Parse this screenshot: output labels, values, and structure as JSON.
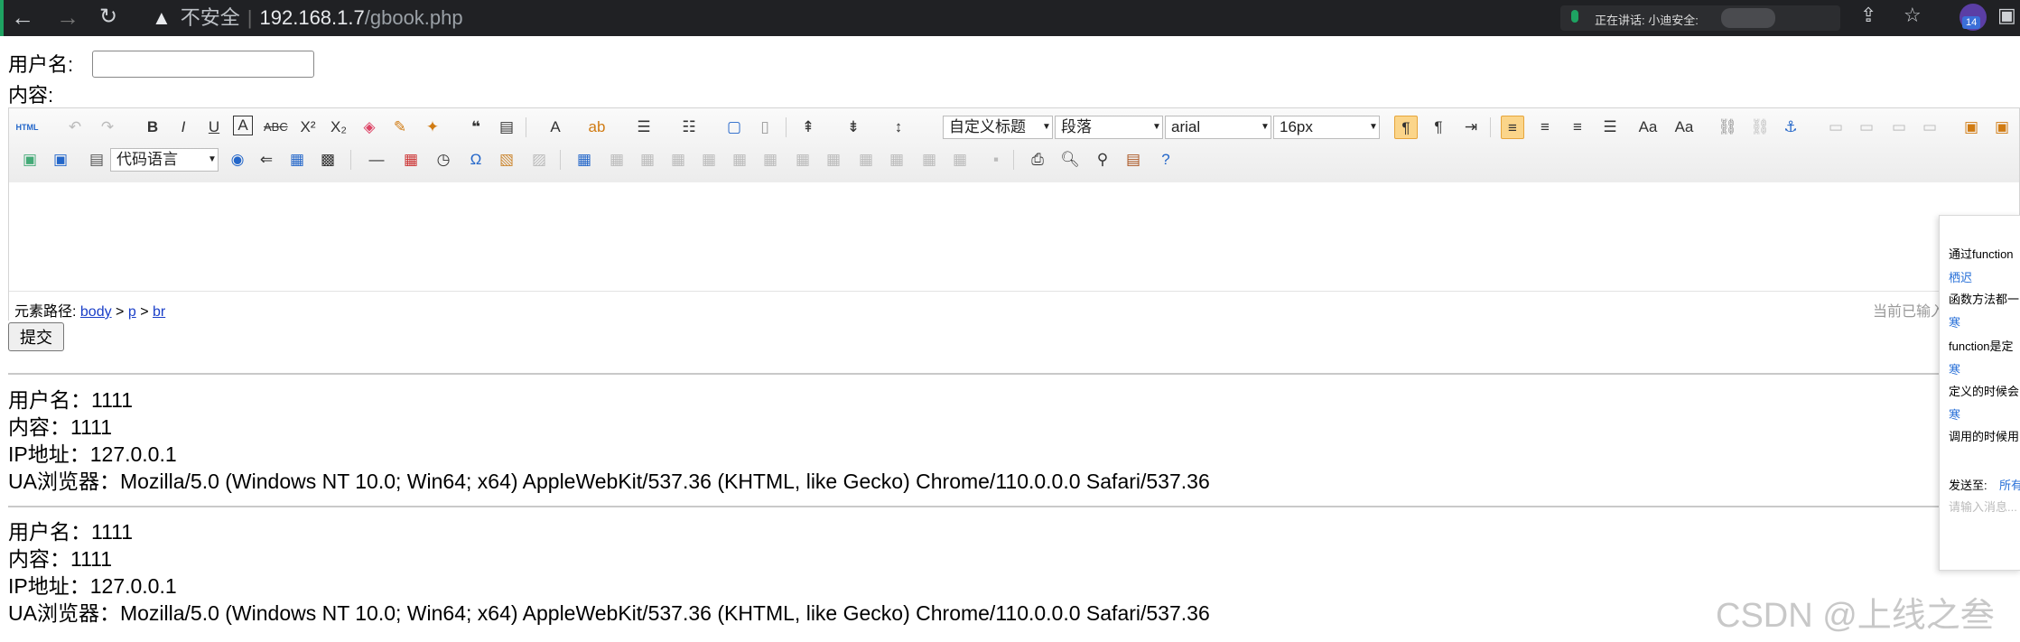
{
  "browser": {
    "security_label": "不安全",
    "url_host": "192.168.1.7",
    "url_path": "/gbook.php",
    "share_status": "正在讲话: 小迪安全:",
    "profile_badge": "14"
  },
  "form": {
    "username_label": "用户名:",
    "content_label": "内容:",
    "submit_label": "提交"
  },
  "editor": {
    "toolbar_row1": [
      "html-source",
      "undo",
      "redo",
      "bold",
      "italic",
      "underline",
      "font-border",
      "strikethrough",
      "superscript",
      "subscript",
      "eraser",
      "format-brush",
      "auto-typeset",
      "blockquote",
      "paste-plain",
      "font-color",
      "background-color",
      "ordered-list",
      "unordered-list",
      "select-all",
      "clear-doc",
      "row-spacing-top",
      "row-spacing-bottom",
      "line-height",
      "ltr",
      "rtl",
      "indent",
      "align-left",
      "align-center",
      "align-right",
      "justify",
      "uppercase",
      "lowercase",
      "link",
      "unlink",
      "anchor",
      "image-none",
      "image-left",
      "image-right",
      "image-center",
      "insert-image",
      "emotion"
    ],
    "toolbar_row2": [
      "image",
      "multi-image",
      "insert-frame",
      "code",
      "page-break",
      "template",
      "horizontal-rule",
      "date",
      "time",
      "special-char",
      "map",
      "wordimage",
      "insert-table",
      "delete-table",
      "insert-paragraph-before-table",
      "insert-row",
      "delete-row",
      "insert-col",
      "delete-col",
      "merge-cells",
      "merge-right",
      "merge-down",
      "split-to-cells",
      "split-to-rows",
      "split-to-cols",
      "print",
      "preview",
      "search-replace",
      "draft",
      "help"
    ],
    "code_language": "代码语言",
    "custom_title": "自定义标题",
    "paragraph": "段落",
    "font_family": "arial",
    "font_size": "16px",
    "path_label": "元素路径:",
    "path_items": [
      "body",
      "p",
      "br"
    ],
    "word_count": "当前已输入"
  },
  "entries": [
    {
      "username": "用户名：1111",
      "content": "内容：1111",
      "ip": "IP地址：127.0.0.1",
      "ua": "UA浏览器：Mozilla/5.0 (Windows NT 10.0; Win64; x64) AppleWebKit/537.36 (KHTML, like Gecko) Chrome/110.0.0.0 Safari/537.36"
    },
    {
      "username": "用户名：1111",
      "content": "内容：1111",
      "ip": "IP地址：127.0.0.1",
      "ua": "UA浏览器：Mozilla/5.0 (Windows NT 10.0; Win64; x64) AppleWebKit/537.36 (KHTML, like Gecko) Chrome/110.0.0.0 Safari/537.36"
    }
  ],
  "side_panel": {
    "messages": [
      "通过function",
      "栖迟",
      "函数方法都一",
      "寒",
      "function是定",
      "寒",
      "定义的时候会",
      "寒",
      "调用的时候用"
    ],
    "send_label": "发送至:",
    "send_target": "所有",
    "input_placeholder": "请输入消息..."
  },
  "watermark": "CSDN @上线之叁"
}
